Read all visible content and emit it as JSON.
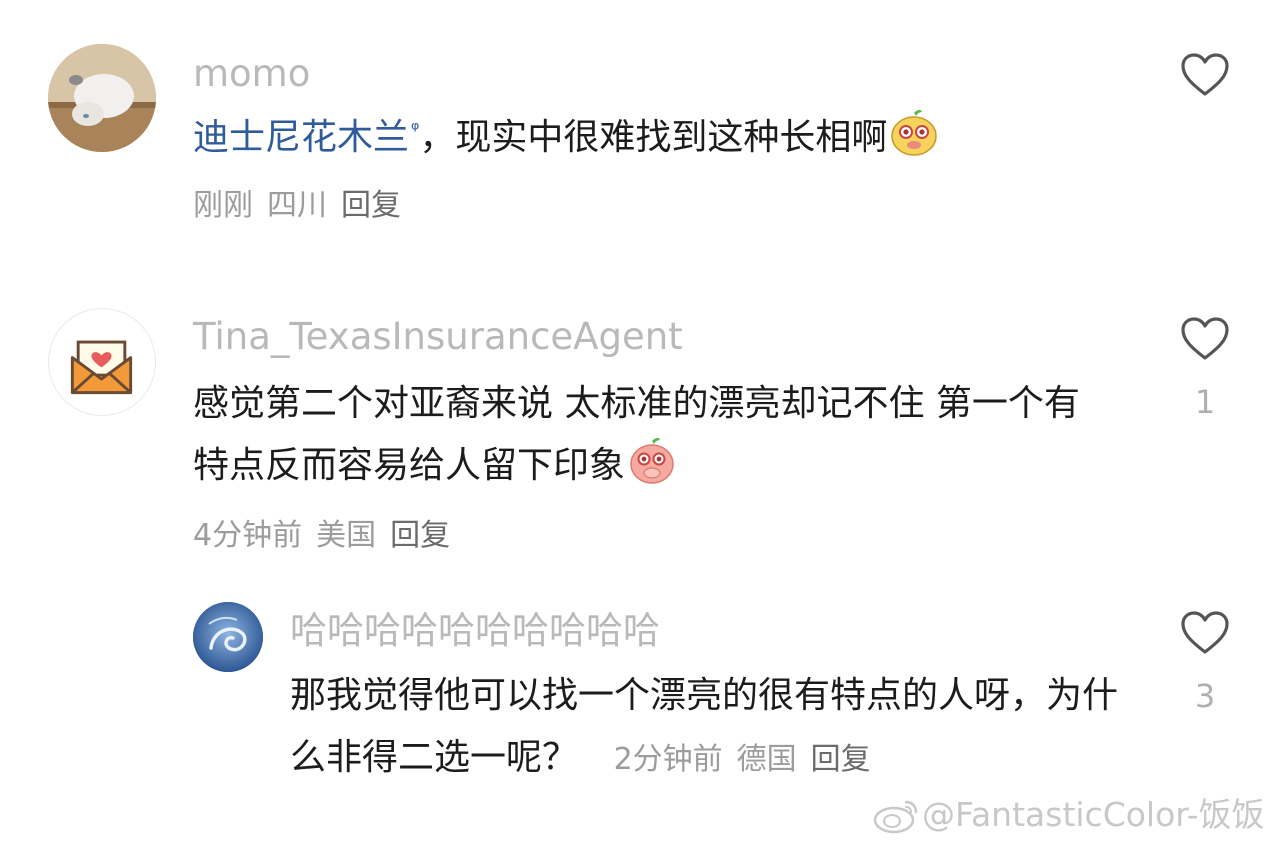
{
  "comments": [
    {
      "username": "momo",
      "text_link": "迪士尼花木兰",
      "text_rest": "，现实中很难找到这种长相啊",
      "emoji": "yellow-face-emoji",
      "time": "刚刚",
      "location": "四川",
      "reply_label": "回复",
      "like_count": ""
    },
    {
      "username": "Tina_TexasInsuranceAgent",
      "text": "感觉第二个对亚裔来说 太标准的漂亮却记不住 第一个有特点反而容易给人留下印象",
      "emoji": "pink-shy-face-emoji",
      "time": "4分钟前",
      "location": "美国",
      "reply_label": "回复",
      "like_count": "1"
    },
    {
      "username": "哈哈哈哈哈哈哈哈哈哈",
      "text": "那我觉得他可以找一个漂亮的很有特点的人呀，为什么非得二选一呢？",
      "time": "2分钟前",
      "location": "德国",
      "reply_label": "回复",
      "like_count": "3"
    }
  ],
  "search_icon": "search-icon",
  "watermark": "@FantasticColor-饭饭",
  "colors": {
    "username": "#b9b9b9",
    "text": "#1c1c1c",
    "meta": "#9c9c9c",
    "link": "#2f5b9a",
    "icon": "#555555"
  }
}
